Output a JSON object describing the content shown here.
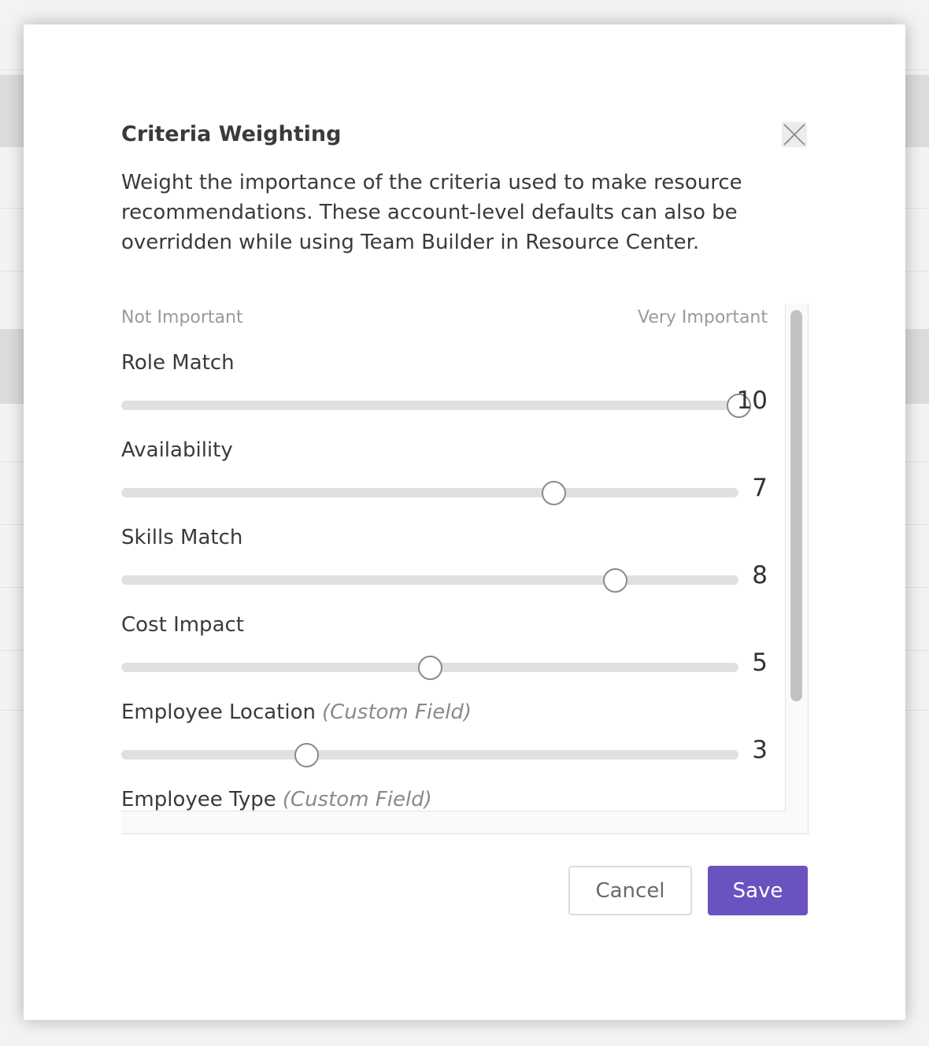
{
  "dialog": {
    "title": "Criteria Weighting",
    "description": "Weight the importance of the criteria used to make resource recommendations. These account-level defaults can also be overridden while using Team Builder in Resource Center.",
    "close_icon": "close-icon"
  },
  "scale": {
    "min_label": "Not Important",
    "max_label": "Very Important",
    "min_value": 0,
    "max_value": 10
  },
  "criteria": [
    {
      "label": "Role Match",
      "custom": "",
      "value": "10",
      "fraction": 1.0
    },
    {
      "label": "Availability",
      "custom": "",
      "value": "7",
      "fraction": 0.7
    },
    {
      "label": "Skills Match",
      "custom": "",
      "value": "8",
      "fraction": 0.8
    },
    {
      "label": "Cost Impact",
      "custom": "",
      "value": "5",
      "fraction": 0.5
    },
    {
      "label": "Employee Location",
      "custom": "(Custom Field)",
      "value": "3",
      "fraction": 0.3
    },
    {
      "label": "Employee Type",
      "custom": "(Custom Field)",
      "value": "",
      "fraction": null
    }
  ],
  "buttons": {
    "cancel": "Cancel",
    "save": "Save"
  },
  "colors": {
    "accent": "#6a53c0",
    "track": "#e0e0e0",
    "thumb_border": "#8a8a8a"
  }
}
